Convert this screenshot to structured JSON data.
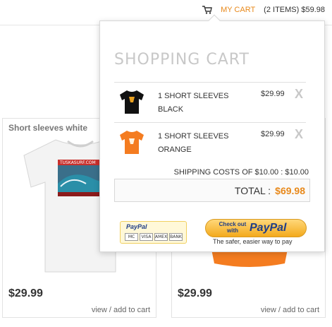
{
  "header": {
    "cart_label": "MY CART",
    "cart_summary": "(2 ITEMS) $59.98",
    "cart_icon": "cart-icon"
  },
  "products": [
    {
      "title": "Short sleeves white",
      "price": "$29.99",
      "link": "view / add to cart",
      "banner_text": "TUSKASURF.COM"
    },
    {
      "title": "",
      "price": "$29.99",
      "link": "view / add to cart"
    }
  ],
  "cart": {
    "heading": "SHOPPING CART",
    "items": [
      {
        "name": "1 SHORT SLEEVES BLACK",
        "price": "$29.99",
        "remove": "X",
        "shirt_color": "#111111",
        "print": "black-tshirt"
      },
      {
        "name": "1 SHORT SLEEVES ORANGE",
        "price": "$29.99",
        "remove": "X",
        "shirt_color": "#f47c20",
        "print": "orange-tshirt"
      }
    ],
    "shipping": "SHIPPING COSTS OF $10.00 : $10.00",
    "total_label": "TOTAL :",
    "total_value": "$69.98",
    "paypal_logo": "PayPal",
    "paypal_cards": [
      "VISA",
      "MC",
      "AMEX",
      "BANK"
    ],
    "checkout_text": "Check out with",
    "checkout_brand": "PayPal",
    "checkout_tagline": "The safer, easier way to pay"
  },
  "colors": {
    "accent": "#e8891b",
    "paypal_blue": "#1f3e87"
  }
}
